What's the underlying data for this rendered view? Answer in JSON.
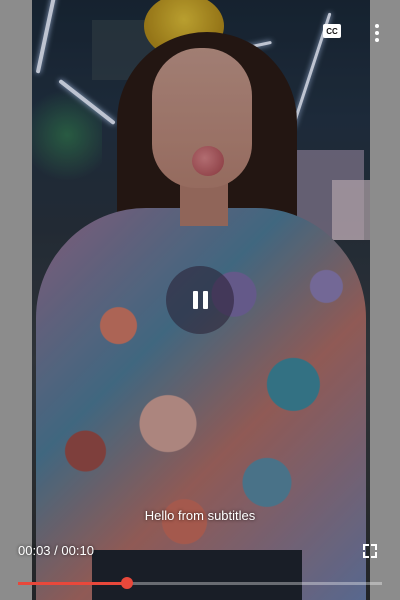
{
  "player": {
    "cc_label": "CC",
    "subtitle_text": "Hello from subtitles",
    "current_time": "00:03",
    "duration": "00:10",
    "time_separator": " / ",
    "progress_fraction": 0.3,
    "accent_color": "#e8483b",
    "state": "playing"
  },
  "icons": {
    "cc": "closed-captions-icon",
    "more": "more-vertical-icon",
    "pause": "pause-icon",
    "fullscreen": "fullscreen-icon"
  }
}
